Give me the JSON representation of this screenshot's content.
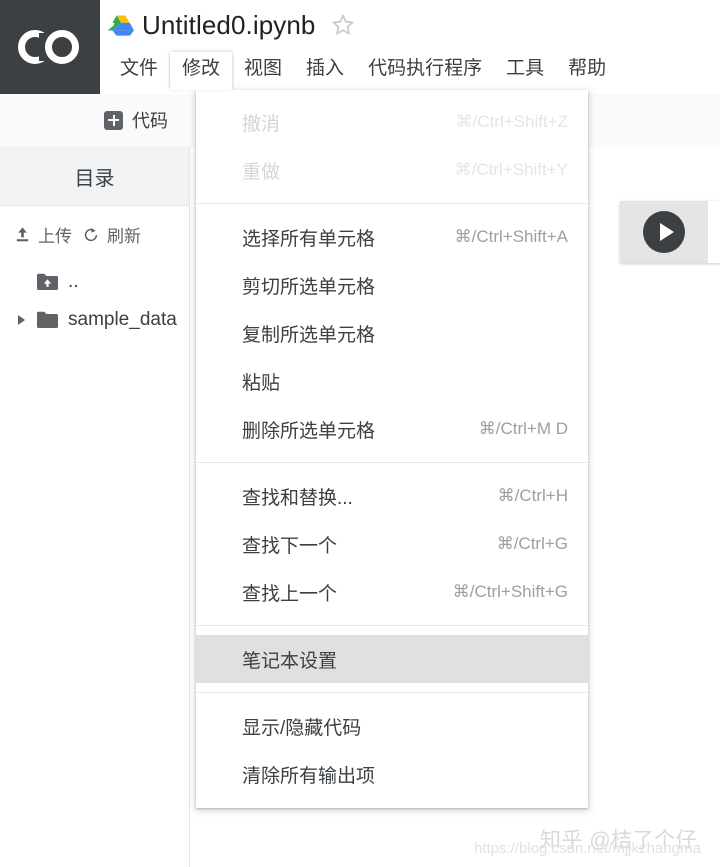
{
  "brand": {
    "logo_text": "CO",
    "logo_bg": "#3c4043"
  },
  "titlebar": {
    "drive_icon": "google-drive-icon",
    "filename": "Untitled0.ipynb",
    "star_icon": "star-outline-icon"
  },
  "menubar": {
    "items": [
      {
        "label": "文件",
        "active": false
      },
      {
        "label": "修改",
        "active": true
      },
      {
        "label": "视图",
        "active": false
      },
      {
        "label": "插入",
        "active": false
      },
      {
        "label": "代码执行程序",
        "active": false
      },
      {
        "label": "工具",
        "active": false
      },
      {
        "label": "帮助",
        "active": false
      }
    ]
  },
  "toolbar": {
    "add_code_label": "代码",
    "add_code_icon": "plus-square-icon"
  },
  "sidebar": {
    "header_title": "目录",
    "tools": [
      {
        "label": "上传",
        "icon": "upload-icon"
      },
      {
        "label": "刷新",
        "icon": "refresh-icon"
      }
    ],
    "tree": [
      {
        "label": "..",
        "icon": "folder-up-icon",
        "has_caret": false
      },
      {
        "label": "sample_data",
        "icon": "folder-icon",
        "has_caret": true
      }
    ]
  },
  "notebook": {
    "cell": {
      "run_icon": "play-button-icon"
    }
  },
  "dropdown": {
    "owner": "修改",
    "groups": [
      {
        "items": [
          {
            "label": "撤消",
            "accel": "⌘/Ctrl+Shift+Z",
            "disabled": true,
            "highlight": false
          },
          {
            "label": "重做",
            "accel": "⌘/Ctrl+Shift+Y",
            "disabled": true,
            "highlight": false
          }
        ]
      },
      {
        "items": [
          {
            "label": "选择所有单元格",
            "accel": "⌘/Ctrl+Shift+A",
            "disabled": false,
            "highlight": false
          },
          {
            "label": "剪切所选单元格",
            "accel": "",
            "disabled": false,
            "highlight": false
          },
          {
            "label": "复制所选单元格",
            "accel": "",
            "disabled": false,
            "highlight": false
          },
          {
            "label": "粘贴",
            "accel": "",
            "disabled": false,
            "highlight": false
          },
          {
            "label": "删除所选单元格",
            "accel": "⌘/Ctrl+M D",
            "disabled": false,
            "highlight": false
          }
        ]
      },
      {
        "items": [
          {
            "label": "查找和替换...",
            "accel": "⌘/Ctrl+H",
            "disabled": false,
            "highlight": false
          },
          {
            "label": "查找下一个",
            "accel": "⌘/Ctrl+G",
            "disabled": false,
            "highlight": false
          },
          {
            "label": "查找上一个",
            "accel": "⌘/Ctrl+Shift+G",
            "disabled": false,
            "highlight": false
          }
        ]
      },
      {
        "items": [
          {
            "label": "笔记本设置",
            "accel": "",
            "disabled": false,
            "highlight": true
          }
        ]
      },
      {
        "items": [
          {
            "label": "显示/隐藏代码",
            "accel": "",
            "disabled": false,
            "highlight": false
          },
          {
            "label": "清除所有输出项",
            "accel": "",
            "disabled": false,
            "highlight": false
          }
        ]
      }
    ]
  },
  "watermarks": {
    "zhihu": "知乎 @桔了个仔",
    "csdn": "https://blog.csdn.net/mjjkzhangma"
  },
  "colors": {
    "logo_bg": "#3c4043",
    "toolbar_bg": "#fafafa",
    "sidebar_header_bg": "#f1f3f4",
    "menu_highlight": "#e0e0e0",
    "code_line": "#e8f0fe",
    "accel_text": "#9aa0a6"
  }
}
